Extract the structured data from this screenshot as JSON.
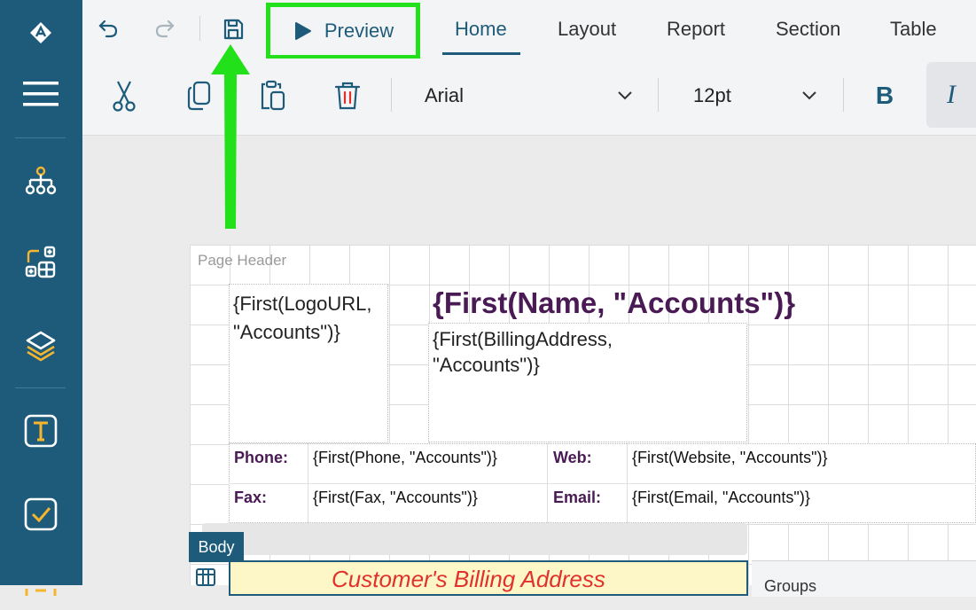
{
  "sidebar": {
    "logo": "app-logo-icon",
    "items": [
      {
        "icon": "hamburger-menu-icon"
      },
      {
        "icon": "hierarchy-tree-icon"
      },
      {
        "icon": "add-components-icon"
      },
      {
        "icon": "layers-icon"
      },
      {
        "icon": "textbox-icon"
      },
      {
        "icon": "checkbox-icon"
      }
    ]
  },
  "topbar": {
    "preview_label": "Preview",
    "tabs": [
      {
        "label": "Home"
      },
      {
        "label": "Layout"
      },
      {
        "label": "Report"
      },
      {
        "label": "Section"
      },
      {
        "label": "Table"
      }
    ],
    "active_tab": "Home"
  },
  "toolbar": {
    "font_family": "Arial",
    "font_size": "12pt",
    "bold_label": "B",
    "italic_label": "I"
  },
  "report": {
    "page_header_label": "Page Header",
    "logo_expr": "{First(LogoURL, \"Accounts\")}",
    "name_expr": "{First(Name, \"Accounts\")}",
    "address_expr": "{First(BillingAddress, \"Accounts\")}",
    "fields": [
      {
        "label": "Phone:",
        "value": "{First(Phone, \"Accounts\")}"
      },
      {
        "label": "Web:",
        "value": "{First(Website, \"Accounts\")}"
      },
      {
        "label": "Fax:",
        "value": "{First(Fax, \"Accounts\")}"
      },
      {
        "label": "Email:",
        "value": "{First(Email, \"Accounts\")}"
      }
    ],
    "body_label": "Body",
    "billing_heading": "Customer's Billing Address",
    "groups_label": "Groups"
  },
  "colors": {
    "sidebar": "#1e5b7a",
    "accent_highlight": "#22e01a",
    "name_text": "#4a1a55",
    "billing_text": "#e0312c",
    "billing_bg": "#fdf6c6"
  }
}
